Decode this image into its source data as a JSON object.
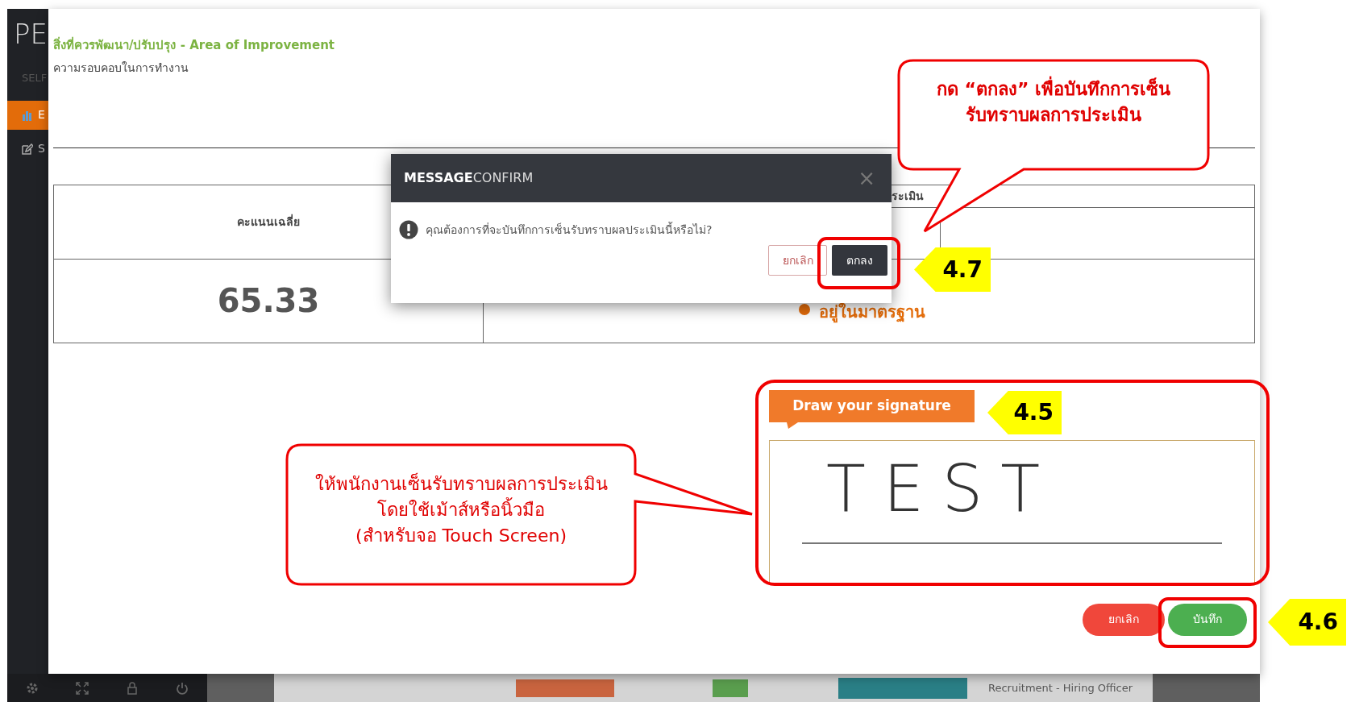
{
  "sidebar": {
    "logo": "PE",
    "section": "SELF",
    "items": [
      {
        "label": "E",
        "selected": true
      },
      {
        "label": "S",
        "selected": false
      }
    ]
  },
  "section": {
    "title": "สิ่งที่ควรพัฒนา/ปรับปรุง - Area of Improvement",
    "text": "ความรอบคอบในการทำงาน"
  },
  "score_table": {
    "columns": [
      "คะแนนเฉลี่ย",
      "ระเมิน"
    ],
    "score": "65.33",
    "result": "อยู่ในมาตรฐาน"
  },
  "signature": {
    "tab": "Draw your signature",
    "drawing": "TEST"
  },
  "buttons": [
    {
      "label": "ยกเลิก",
      "kind": "cancel"
    },
    {
      "label": "บันทึก",
      "kind": "save"
    }
  ],
  "dialog": {
    "title": "**MESSAGE**CONFIRM",
    "close": "×",
    "message": "คุณต้องการที่จะบันทึกการเซ็นรับทราบผลประเมินนี้หรือไม่?",
    "buttons": [
      {
        "label": "ยกเลิก",
        "kind": "cancel"
      },
      {
        "label": "ตกลง",
        "kind": "ok"
      }
    ]
  },
  "background_row": {
    "text": "Recruitment - Hiring Officer"
  },
  "annotations": {
    "callouts": [
      {
        "lines": [
          "กด “ตกลง” เพื่อบันทึกการเซ็น",
          "รับทราบผลการประเมิน"
        ]
      },
      {
        "lines": [
          "ให้พนักงานเซ็นรับทราบผลการประเมิน",
          "โดยใช้เม้าส์หรือนิ้วมือ",
          "(สำหรับจอ Touch Screen)"
        ]
      }
    ],
    "steps": [
      "4.7",
      "4.5",
      "4.6"
    ]
  }
}
